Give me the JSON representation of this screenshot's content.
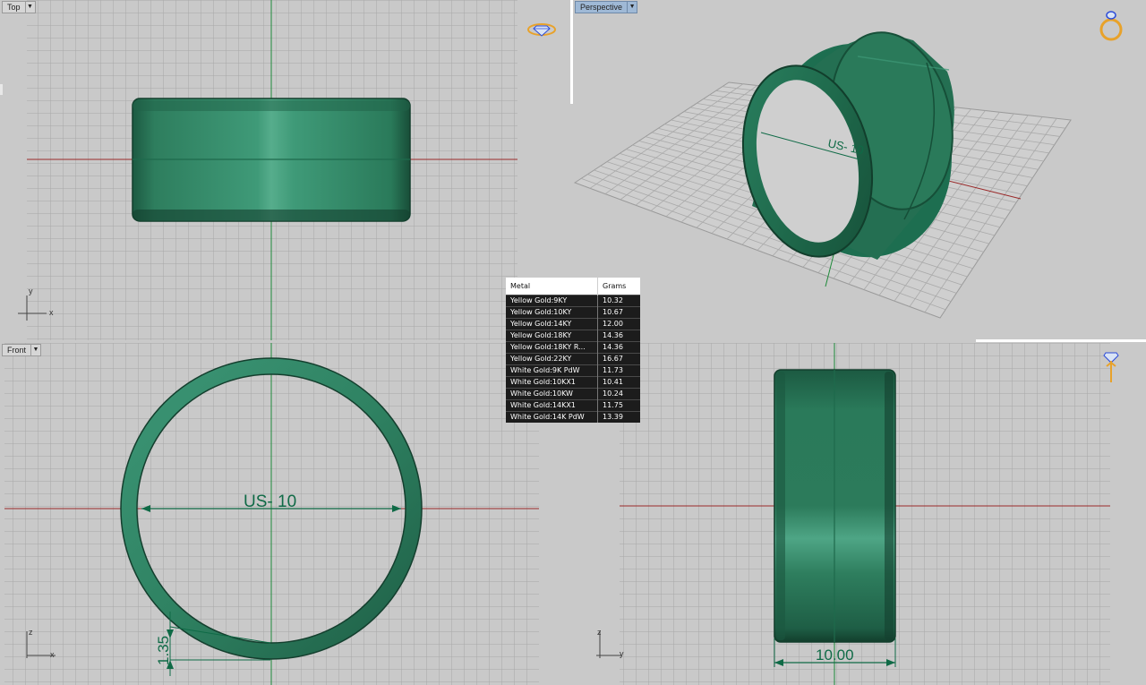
{
  "viewports": {
    "top": {
      "title": "Top",
      "axis_y": "y",
      "axis_x": "x"
    },
    "perspective": {
      "title": "Perspective",
      "size_label": "US- 10"
    },
    "front": {
      "title": "Front",
      "axis_z": "z",
      "axis_x": "x",
      "size_label": "US- 10",
      "thickness_label": "1.35"
    },
    "right": {
      "axis_z": "z",
      "axis_y": "y",
      "width_label": "10.00"
    }
  },
  "metal_table": {
    "headers": [
      "Metal",
      "Grams"
    ],
    "rows": [
      {
        "metal": "Yellow Gold:9KY",
        "grams": "10.32"
      },
      {
        "metal": "Yellow Gold:10KY",
        "grams": "10.67"
      },
      {
        "metal": "Yellow Gold:14KY",
        "grams": "12.00"
      },
      {
        "metal": "Yellow Gold:18KY",
        "grams": "14.36"
      },
      {
        "metal": "Yellow Gold:18KY R...",
        "grams": "14.36"
      },
      {
        "metal": "Yellow Gold:22KY",
        "grams": "16.67"
      },
      {
        "metal": "White Gold:9K PdW",
        "grams": "11.73"
      },
      {
        "metal": "White Gold:10KX1",
        "grams": "10.41"
      },
      {
        "metal": "White Gold:10KW",
        "grams": "10.24"
      },
      {
        "metal": "White Gold:14KX1",
        "grams": "11.75"
      },
      {
        "metal": "White Gold:14K PdW",
        "grams": "13.39"
      }
    ]
  },
  "icons": [
    "diamond-icon",
    "ring-icon",
    "diamond-small-icon",
    "dropdown-arrow-icon"
  ],
  "colors": {
    "ring_green": "#2a8a64",
    "grid_bg": "#c9c9c9",
    "grid_line": "#a9a9a9",
    "x_axis": "#9a2a2a",
    "y_axis": "#1f8a3a",
    "icon_gold": "#e8a22a",
    "icon_blue": "#2a4ad8"
  }
}
